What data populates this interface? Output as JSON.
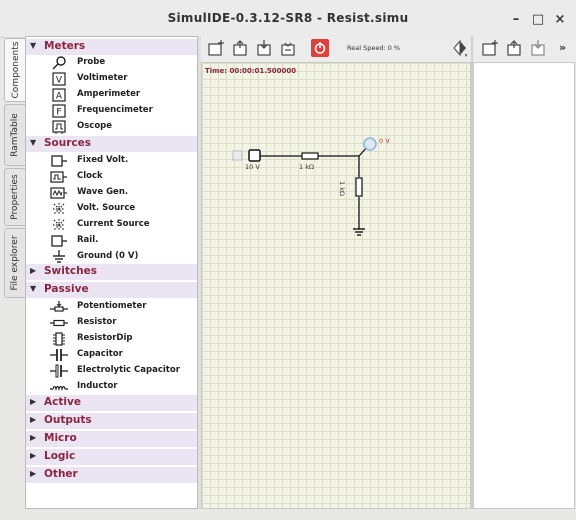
{
  "window": {
    "title": "SimulIDE-0.3.12-SR8  -  Resist.simu",
    "minimize": "–",
    "maximize": "□",
    "close": "×"
  },
  "side_tabs": [
    "Components",
    "RamTable",
    "Properties",
    "File explorer"
  ],
  "categories": [
    {
      "label": "Meters",
      "expanded": true,
      "items": [
        "Probe",
        "Voltimeter",
        "Amperimeter",
        "Frequencimeter",
        "Oscope"
      ]
    },
    {
      "label": "Sources",
      "expanded": true,
      "items": [
        "Fixed Volt.",
        "Clock",
        "Wave Gen.",
        "Volt. Source",
        "Current Source",
        "Rail.",
        "Ground (0 V)"
      ]
    },
    {
      "label": "Switches",
      "expanded": false,
      "items": []
    },
    {
      "label": "Passive",
      "expanded": true,
      "items": [
        "Potentiometer",
        "Resistor",
        "ResistorDip",
        "Capacitor",
        "Electrolytic Capacitor",
        "Inductor"
      ]
    },
    {
      "label": "Active",
      "expanded": false,
      "items": []
    },
    {
      "label": "Outputs",
      "expanded": false,
      "items": []
    },
    {
      "label": "Micro",
      "expanded": false,
      "items": []
    },
    {
      "label": "Logic",
      "expanded": false,
      "items": []
    },
    {
      "label": "Other",
      "expanded": false,
      "items": []
    }
  ],
  "toolbar": {
    "real_speed": "Real Speed: 0 %",
    "more": "»"
  },
  "canvas": {
    "time": "Time: 00:00:01.500000",
    "source_label": "10 V",
    "resistor1_label": "1 kΩ",
    "resistor2_label": "1 kΩ",
    "probe_label": "0 V"
  },
  "colors": {
    "category_text": "#8a2540",
    "category_bg": "#ebe4f2",
    "canvas_bg": "#f3f4e6",
    "grid": "#dcdfc7",
    "stop_button": "#e0403a",
    "probe": "#8fb3e0"
  }
}
